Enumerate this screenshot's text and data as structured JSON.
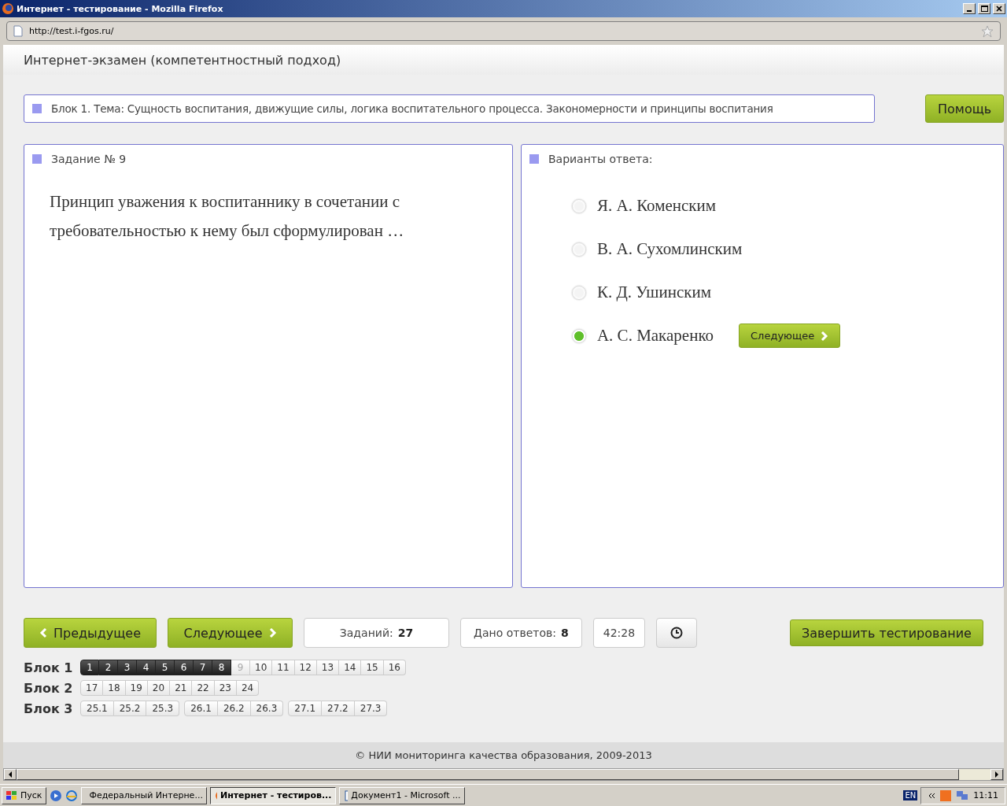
{
  "window": {
    "title": "Интернет - тестирование - Mozilla Firefox"
  },
  "address_bar": {
    "value": "http://test.i-fgos.ru/"
  },
  "page_title": "Интернет-экзамен (компетентностный подход)",
  "topic": "Блок 1. Тема: Сущность воспитания, движущие силы, логика воспитательного процесса. Закономерности и принципы воспитания",
  "help_button": "Помощь",
  "task": {
    "heading": "Задание № 9",
    "text": "Принцип уважения к воспитаннику в сочетании с требовательностью к нему был сформулирован …"
  },
  "answers": {
    "heading": "Варианты ответа:",
    "next_button": "Следующее",
    "options": [
      {
        "label": "Я. А. Коменским",
        "selected": false
      },
      {
        "label": "В. А. Сухомлинским",
        "selected": false
      },
      {
        "label": "К. Д. Ушинским",
        "selected": false
      },
      {
        "label": "А. С. Макаренко",
        "selected": true
      }
    ]
  },
  "controls": {
    "prev": "Предыдущее",
    "next": "Следующее",
    "tasks_label": "Заданий:",
    "tasks_value": "27",
    "answered_label": "Дано ответов:",
    "answered_value": "8",
    "timer": "42:28",
    "finish": "Завершить тестирование"
  },
  "blocks": [
    {
      "label": "Блок 1",
      "groups": [
        [
          {
            "n": "1",
            "answered": true,
            "selected": false
          },
          {
            "n": "2",
            "answered": true,
            "selected": false
          },
          {
            "n": "3",
            "answered": true,
            "selected": false
          },
          {
            "n": "4",
            "answered": true,
            "selected": false
          },
          {
            "n": "5",
            "answered": true,
            "selected": false
          },
          {
            "n": "6",
            "answered": true,
            "selected": false
          },
          {
            "n": "7",
            "answered": true,
            "selected": false
          },
          {
            "n": "8",
            "answered": true,
            "selected": false
          },
          {
            "n": "9",
            "answered": false,
            "selected": true
          },
          {
            "n": "10",
            "answered": false,
            "selected": false
          },
          {
            "n": "11",
            "answered": false,
            "selected": false
          },
          {
            "n": "12",
            "answered": false,
            "selected": false
          },
          {
            "n": "13",
            "answered": false,
            "selected": false
          },
          {
            "n": "14",
            "answered": false,
            "selected": false
          },
          {
            "n": "15",
            "answered": false,
            "selected": false
          },
          {
            "n": "16",
            "answered": false,
            "selected": false
          }
        ]
      ]
    },
    {
      "label": "Блок 2",
      "groups": [
        [
          {
            "n": "17",
            "answered": false,
            "selected": false
          },
          {
            "n": "18",
            "answered": false,
            "selected": false
          },
          {
            "n": "19",
            "answered": false,
            "selected": false
          },
          {
            "n": "20",
            "answered": false,
            "selected": false
          },
          {
            "n": "21",
            "answered": false,
            "selected": false
          },
          {
            "n": "22",
            "answered": false,
            "selected": false
          },
          {
            "n": "23",
            "answered": false,
            "selected": false
          },
          {
            "n": "24",
            "answered": false,
            "selected": false
          }
        ]
      ]
    },
    {
      "label": "Блок 3",
      "groups": [
        [
          {
            "n": "25.1",
            "answered": false,
            "selected": false
          },
          {
            "n": "25.2",
            "answered": false,
            "selected": false
          },
          {
            "n": "25.3",
            "answered": false,
            "selected": false
          }
        ],
        [
          {
            "n": "26.1",
            "answered": false,
            "selected": false
          },
          {
            "n": "26.2",
            "answered": false,
            "selected": false
          },
          {
            "n": "26.3",
            "answered": false,
            "selected": false
          }
        ],
        [
          {
            "n": "27.1",
            "answered": false,
            "selected": false
          },
          {
            "n": "27.2",
            "answered": false,
            "selected": false
          },
          {
            "n": "27.3",
            "answered": false,
            "selected": false
          }
        ]
      ]
    }
  ],
  "footer": "© НИИ мониторинга качества образования, 2009-2013",
  "taskbar": {
    "start": "Пуск",
    "tasks": [
      {
        "label": "Федеральный Интерне...",
        "selected": false
      },
      {
        "label": "Интернет - тестиров...",
        "selected": true
      },
      {
        "label": "Документ1 - Microsoft ...",
        "selected": false
      }
    ],
    "language": "EN",
    "clock": "11:11"
  }
}
